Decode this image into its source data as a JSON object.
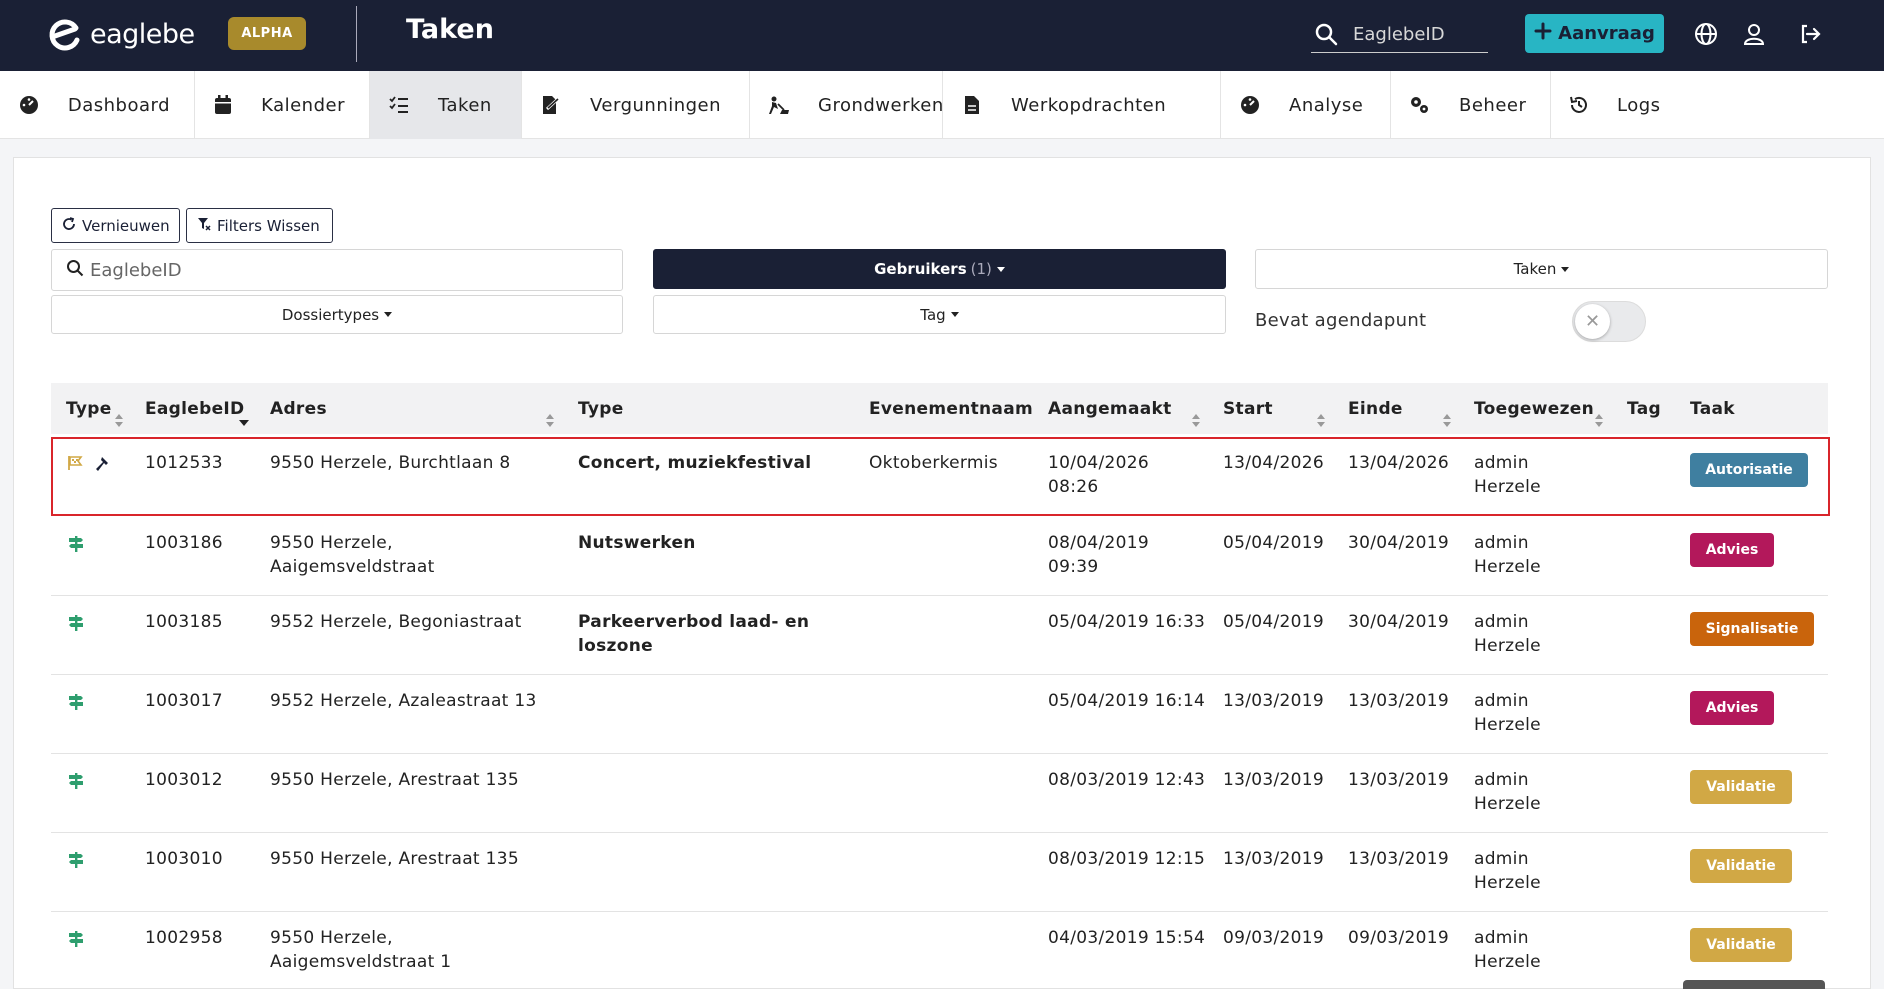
{
  "header": {
    "logo_text": "eaglebe",
    "badge": "ALPHA",
    "title": "Taken",
    "search_placeholder": "EaglebeID",
    "request_button": "Aanvraag",
    "colors": {
      "background": "#1a2035",
      "accent": "#28b5c4",
      "badge": "#a88a2c"
    }
  },
  "nav": [
    {
      "label": "Dashboard",
      "icon": "dashboard-icon"
    },
    {
      "label": "Kalender",
      "icon": "calendar-icon"
    },
    {
      "label": "Taken",
      "icon": "tasks-icon",
      "active": true
    },
    {
      "label": "Vergunningen",
      "icon": "permit-icon"
    },
    {
      "label": "Grondwerken",
      "icon": "digging-icon"
    },
    {
      "label": "Werkopdrachten",
      "icon": "document-icon"
    },
    {
      "label": "Analyse",
      "icon": "analysis-icon"
    },
    {
      "label": "Beheer",
      "icon": "cogs-icon"
    },
    {
      "label": "Logs",
      "icon": "history-icon"
    }
  ],
  "filters": {
    "refresh": "Vernieuwen",
    "clear": "Filters Wissen",
    "search_placeholder": "EaglebeID",
    "users": "Gebruikers",
    "users_count": "(1)",
    "tasks": "Taken",
    "dossier_types": "Dossiertypes",
    "tag": "Tag",
    "agenda_label": "Bevat agendapunt",
    "agenda_toggle": false
  },
  "table": {
    "headers": [
      "Type",
      "EaglebeID",
      "Adres",
      "Type",
      "Evenementnaam",
      "Aangemaakt",
      "Start",
      "Einde",
      "Toegewezen",
      "Tag",
      "Taak"
    ],
    "rows": [
      {
        "id": "1012533",
        "address": [
          "9550 Herzele, Burchtlaan 8",
          ""
        ],
        "type": [
          "Concert, muziekfestival",
          ""
        ],
        "event": "Oktoberkermis",
        "created": [
          "10/04/2026",
          "08:26"
        ],
        "start": "13/04/2026",
        "end": "13/04/2026",
        "assigned": [
          "admin",
          "Herzele"
        ],
        "task": "Autorisatie",
        "task_color": "#3f7fa0",
        "icons": [
          "event-flag-icon",
          "hammer-icon"
        ],
        "highlight": true
      },
      {
        "id": "1003186",
        "address": [
          "9550 Herzele,",
          "Aaigemsveldstraat"
        ],
        "type": [
          "Nutswerken",
          ""
        ],
        "event": "",
        "created": [
          "08/04/2019",
          "09:39"
        ],
        "start": "05/04/2019",
        "end": "30/04/2019",
        "assigned": [
          "admin",
          "Herzele"
        ],
        "task": "Advies",
        "task_color": "#b3185b",
        "icons": [
          "signpost-icon"
        ]
      },
      {
        "id": "1003185",
        "address": [
          "9552 Herzele, Begoniastraat",
          ""
        ],
        "type": [
          "Parkeerverbod laad- en",
          "loszone"
        ],
        "event": "",
        "created": [
          "05/04/2019 16:33",
          ""
        ],
        "start": "05/04/2019",
        "end": "30/04/2019",
        "assigned": [
          "admin",
          "Herzele"
        ],
        "task": "Signalisatie",
        "task_color": "#c9640c",
        "icons": [
          "signpost-icon"
        ]
      },
      {
        "id": "1003017",
        "address": [
          "9552 Herzele, Azaleastraat 13",
          ""
        ],
        "type": [
          "",
          ""
        ],
        "event": "",
        "created": [
          "05/04/2019 16:14",
          ""
        ],
        "start": "13/03/2019",
        "end": "13/03/2019",
        "assigned": [
          "admin",
          "Herzele"
        ],
        "task": "Advies",
        "task_color": "#b3185b",
        "icons": [
          "signpost-icon"
        ]
      },
      {
        "id": "1003012",
        "address": [
          "9550 Herzele, Arestraat 135",
          ""
        ],
        "type": [
          "",
          ""
        ],
        "event": "",
        "created": [
          "08/03/2019 12:43",
          ""
        ],
        "start": "13/03/2019",
        "end": "13/03/2019",
        "assigned": [
          "admin",
          "Herzele"
        ],
        "task": "Validatie",
        "task_color": "#d1a845",
        "icons": [
          "signpost-icon"
        ]
      },
      {
        "id": "1003010",
        "address": [
          "9550 Herzele, Arestraat 135",
          ""
        ],
        "type": [
          "",
          ""
        ],
        "event": "",
        "created": [
          "08/03/2019 12:15",
          ""
        ],
        "start": "13/03/2019",
        "end": "13/03/2019",
        "assigned": [
          "admin",
          "Herzele"
        ],
        "task": "Validatie",
        "task_color": "#d1a845",
        "icons": [
          "signpost-icon"
        ]
      },
      {
        "id": "1002958",
        "address": [
          "9550 Herzele,",
          "Aaigemsveldstraat 1"
        ],
        "type": [
          "",
          ""
        ],
        "event": "",
        "created": [
          "04/03/2019 15:54",
          ""
        ],
        "start": "09/03/2019",
        "end": "09/03/2019",
        "assigned": [
          "admin",
          "Herzele"
        ],
        "task": "Validatie",
        "task_color": "#d1a845",
        "icons": [
          "signpost-icon"
        ]
      }
    ]
  }
}
